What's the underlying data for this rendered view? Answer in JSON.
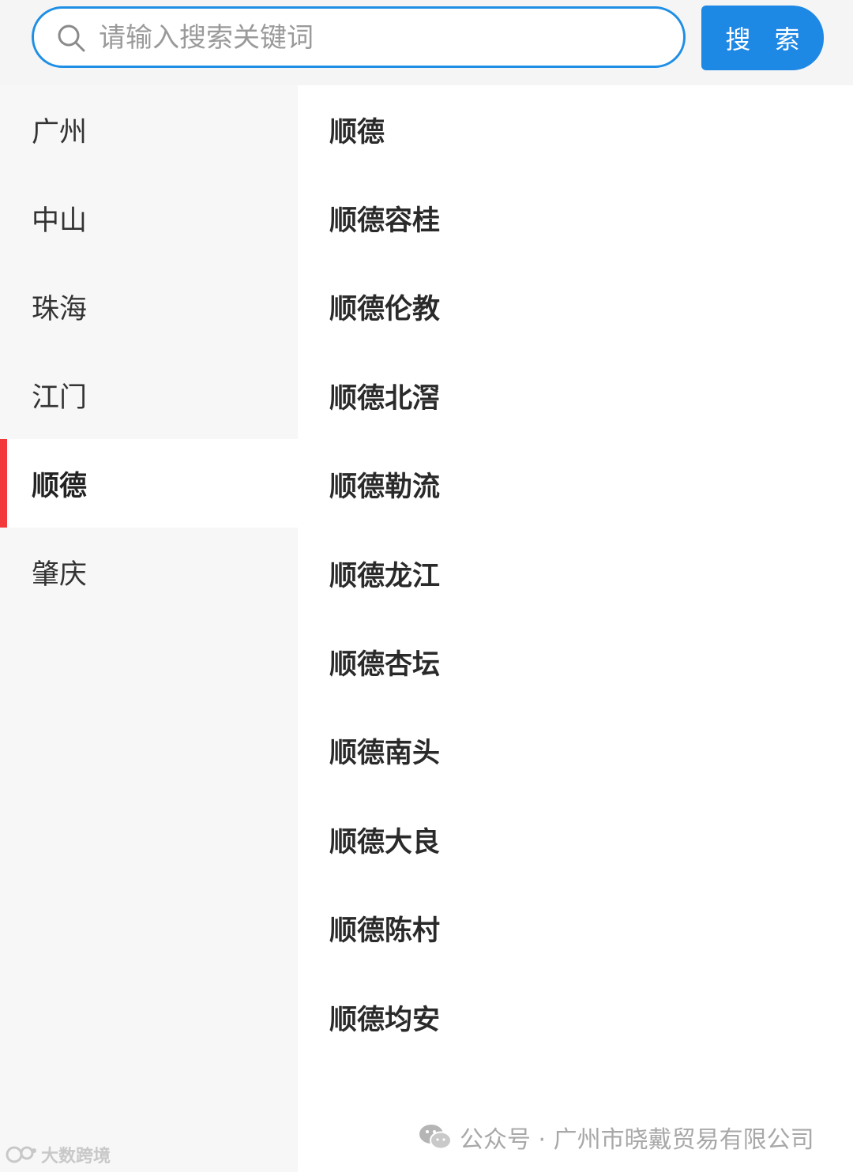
{
  "search": {
    "placeholder": "请输入搜索关键词",
    "button_label": "搜 索"
  },
  "sidebar": {
    "items": [
      {
        "label": "广州",
        "active": false
      },
      {
        "label": "中山",
        "active": false
      },
      {
        "label": "珠海",
        "active": false
      },
      {
        "label": "江门",
        "active": false
      },
      {
        "label": "顺德",
        "active": true
      },
      {
        "label": "肇庆",
        "active": false
      }
    ]
  },
  "districts": [
    "顺德",
    "顺德容桂",
    "顺德伦教",
    "顺德北滘",
    "顺德勒流",
    "顺德龙江",
    "顺德杏坛",
    "顺德南头",
    "顺德大良",
    "顺德陈村",
    "顺德均安"
  ],
  "watermark": {
    "text": "公众号 · 广州市晓戴贸易有限公司",
    "brand": "大数跨境"
  },
  "colors": {
    "accent": "#1e88e5",
    "active_indicator": "#f23a3a",
    "sidebar_bg": "#f7f7f7"
  }
}
